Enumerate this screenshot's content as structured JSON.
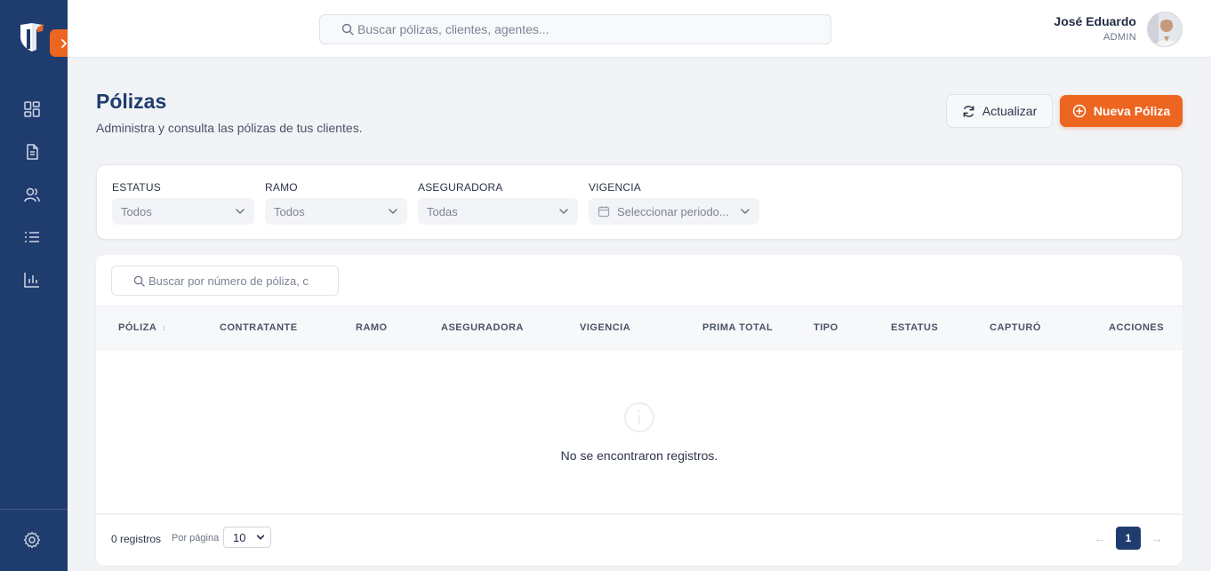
{
  "header": {
    "search_placeholder": "Buscar pólizas, clientes, agentes...",
    "user_name": "José Eduardo",
    "user_role": "ADMIN"
  },
  "sidebar": {
    "items": [
      {
        "icon": "dashboard-icon"
      },
      {
        "icon": "document-icon"
      },
      {
        "icon": "users-icon"
      },
      {
        "icon": "list-icon"
      },
      {
        "icon": "chart-icon"
      }
    ],
    "footer_icon": "settings-icon"
  },
  "page": {
    "title": "Pólizas",
    "subtitle": "Administra y consulta las pólizas de tus clientes.",
    "refresh_label": "Actualizar",
    "new_label": "Nueva Póliza"
  },
  "filters": {
    "status": {
      "label": "ESTATUS",
      "value": "Todos"
    },
    "ramo": {
      "label": "RAMO",
      "value": "Todos"
    },
    "aseguradora": {
      "label": "ASEGURADORA",
      "value": "Todas"
    },
    "vigencia": {
      "label": "VIGENCIA",
      "value": "Seleccionar periodo..."
    }
  },
  "table": {
    "search_placeholder": "Buscar por número de póliza, c",
    "columns": [
      "PÓLIZA",
      "CONTRATANTE",
      "RAMO",
      "ASEGURADORA",
      "VIGENCIA",
      "PRIMA TOTAL",
      "TIPO",
      "ESTATUS",
      "CAPTURÓ",
      "ACCIONES"
    ],
    "empty_text": "No se encontraron registros.",
    "records_text": "0 registros",
    "per_page_label": "Por página",
    "per_page_value": "10",
    "current_page": "1"
  },
  "colors": {
    "sidebar": "#1f3c6e",
    "accent": "#ec6521",
    "background": "#f1f3f6"
  }
}
